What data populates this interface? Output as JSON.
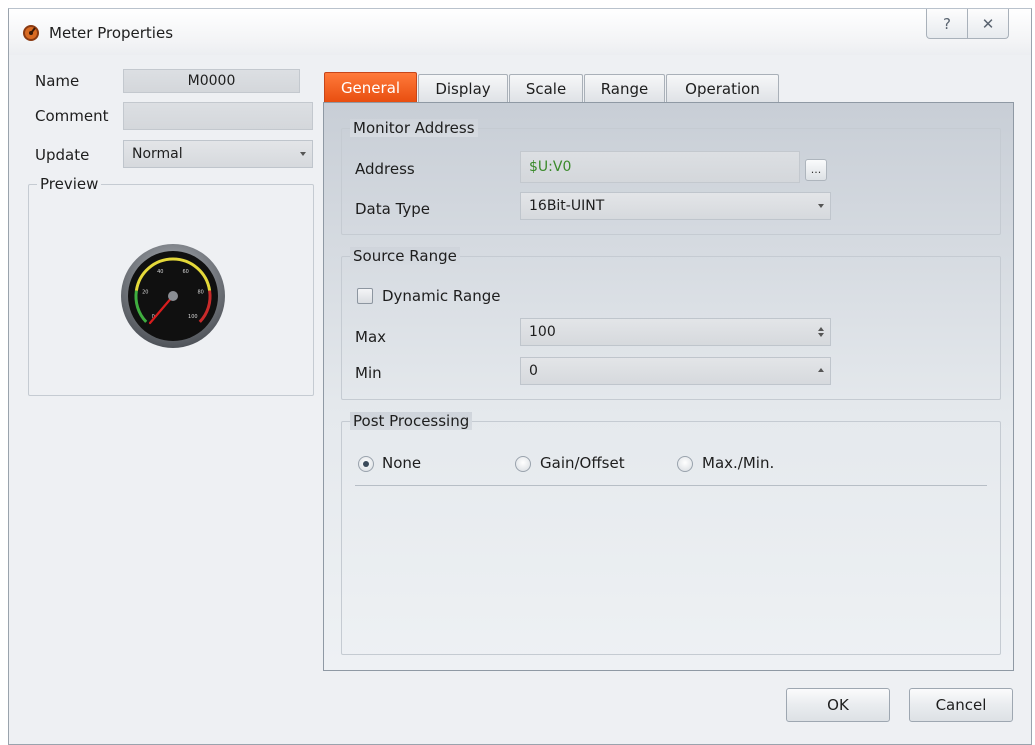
{
  "window": {
    "title": "Meter Properties",
    "help_glyph": "?",
    "close_glyph": "✕"
  },
  "left": {
    "name_label": "Name",
    "name_value": "M0000",
    "comment_label": "Comment",
    "comment_value": "",
    "update_label": "Update",
    "update_value": "Normal",
    "preview_title": "Preview"
  },
  "gauge": {
    "ticks": [
      "0",
      "20",
      "40",
      "60",
      "80",
      "100"
    ],
    "value": 0,
    "colors": {
      "bezel": "#6e7278",
      "face": "#101010",
      "needle": "#d81d1d",
      "low_zone": "#3fae3f",
      "mid_zone": "#e5d93a",
      "high_zone": "#c92a2a"
    }
  },
  "tabs": [
    {
      "label": "General",
      "active": true
    },
    {
      "label": "Display",
      "active": false
    },
    {
      "label": "Scale",
      "active": false
    },
    {
      "label": "Range",
      "active": false
    },
    {
      "label": "Operation",
      "active": false
    }
  ],
  "monitor": {
    "title": "Monitor Address",
    "address_label": "Address",
    "address_value": "$U:V0",
    "browse_label": "...",
    "datatype_label": "Data Type",
    "datatype_value": "16Bit-UINT"
  },
  "source": {
    "title": "Source Range",
    "dynamic_label": "Dynamic Range",
    "dynamic_checked": false,
    "max_label": "Max",
    "max_value": "100",
    "min_label": "Min",
    "min_value": "0"
  },
  "post": {
    "title": "Post Processing",
    "options": [
      {
        "label": "None",
        "checked": true
      },
      {
        "label": "Gain/Offset",
        "checked": false
      },
      {
        "label": "Max./Min.",
        "checked": false
      }
    ]
  },
  "buttons": {
    "ok": "OK",
    "cancel": "Cancel"
  },
  "colors": {
    "active_tab": "#ee5a18",
    "address_text": "#3a8a2a",
    "panel_top": "#c8ced6"
  }
}
